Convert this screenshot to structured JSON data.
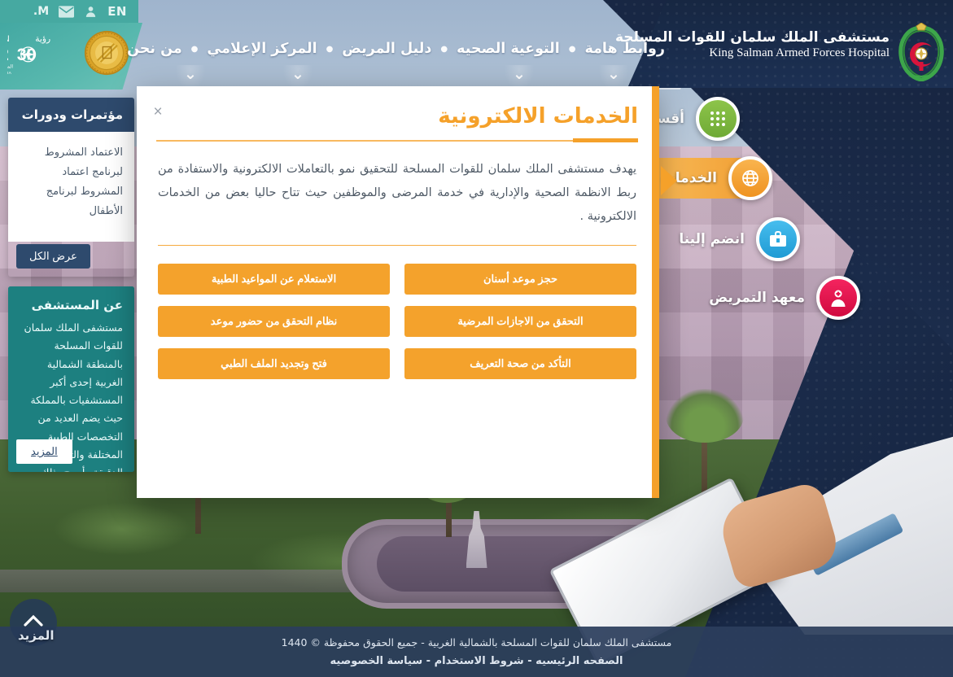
{
  "utility_bar": {
    "lang_label": "EN",
    "m_label": "M.",
    "user_icon": "user-icon",
    "mail_icon": "envelope-icon"
  },
  "header": {
    "brand_ar": "مستشفى الملك سلمان للقوات المسلحة",
    "brand_en": "King Salman Armed Forces Hospital",
    "vision_title": "VISION",
    "vision_ar": "رؤية",
    "vision_year": "2030",
    "vision_kingdom_ar": "المملكة العربية السعودية",
    "vision_kingdom_en": "KINGDOM OF SAUDI ARABIA",
    "nav": [
      {
        "label": "من نحن"
      },
      {
        "label": "المركز الإعلامي"
      },
      {
        "label": "دليل المريض"
      },
      {
        "label": "التوعية الصحيه"
      },
      {
        "label": "روابط هامة"
      }
    ]
  },
  "left_cards": {
    "events": {
      "title": "مؤتمرات ودورات",
      "body": "الاعتماد المشروط لبرنامج اعتماد المشروط لبرنامج الأطفال",
      "button": "عرض الكل"
    },
    "about": {
      "title": "عن المستشفى",
      "body": "مستشفى الملك سلمان للقوات المسلحة بالمنطقة الشمالية الغربية إحدى أكبر المستشفيات بالمملكة حيث يضم العديد من التخصصات الطبية المختلفة والتجهيزات الدقيقة وأصبح بذلك مرجعاً لجميع مستشفيات المنطقة الشمالية الغربية.",
      "button": "المزيد"
    }
  },
  "side_menu": [
    {
      "label": "أقسام المستشفى",
      "icon": "grid-icon",
      "color": "#7cb342",
      "active": false
    },
    {
      "label": "الخدمات الالكترونية",
      "icon": "globe-icon",
      "color": "#f5a12a",
      "active": true
    },
    {
      "label": "انضم إلينا",
      "icon": "briefcase-icon",
      "color": "#29a9e0",
      "active": false
    },
    {
      "label": "معهد التمريض",
      "icon": "nurse-icon",
      "color": "#e8114b",
      "active": false
    }
  ],
  "modal": {
    "title": "الخدمات الالكترونية",
    "close_label": "×",
    "description": "يهدف مستشفى الملك سلمان للقوات المسلحة للتحقيق نمو بالتعاملات الالكترونية والاستفادة من ربط الانظمة الصحية والإدارية في خدمة المرضى والموظفين حيث تتاح حاليا بعض من الخدمات الالكترونية .",
    "services": [
      {
        "label": "حجز موعد أسنان"
      },
      {
        "label": "الاستعلام عن المواعيد الطبية"
      },
      {
        "label": "التحقق من الاجازات المرضية"
      },
      {
        "label": "نظام التحقق من حضور موعد"
      },
      {
        "label": "التأكد من صحة التعريف"
      },
      {
        "label": "فتح وتجديد الملف الطبي"
      }
    ]
  },
  "scroll_top": {
    "label": "المزيد",
    "icon": "chevron-up-icon"
  },
  "footer": {
    "copyright": "مستشفى الملك سلمان للقوات المسلحة بالشمالية الغربية - جميع الحقوق محفوظة © 1440",
    "links": [
      {
        "label": "الصفحه الرئيسيه"
      },
      {
        "label": "شروط الاستخدام"
      },
      {
        "label": "سياسة الخصوصيه"
      }
    ],
    "separator": "-"
  },
  "colors": {
    "orange": "#f5a12a",
    "navy": "#2e4a6d",
    "teal": "#1d8080",
    "util_teal": "#46a9a1"
  }
}
